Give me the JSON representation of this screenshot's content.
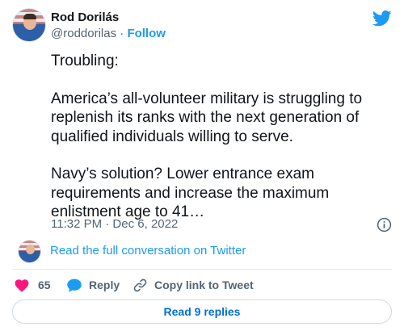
{
  "author": {
    "display_name": "Rod Dorilás",
    "handle": "@roddorilas",
    "separator": "·",
    "follow_label": "Follow"
  },
  "tweet": {
    "paragraphs": [
      "Troubling:",
      "America’s all-volunteer military is struggling to replenish its ranks with the next generation of qualified individuals willing to serve.",
      "Navy’s solution? Lower entrance exam requirements and increase the maximum enlistment age to 41…"
    ],
    "timestamp": "11:32 PM · Dec 6, 2022"
  },
  "conversation": {
    "link_label": "Read the full conversation on Twitter"
  },
  "actions": {
    "like_count": "65",
    "reply_label": "Reply",
    "copy_label": "Copy link to Tweet"
  },
  "footer": {
    "read_replies_label": "Read 9 replies"
  },
  "icons": {
    "brand": "twitter-bird-icon",
    "info": "info-icon",
    "like": "heart-icon",
    "reply": "speech-bubble-icon",
    "copy": "link-icon"
  },
  "colors": {
    "brand_blue": "#1d9bf0",
    "like_pink": "#f91880",
    "reply_blue": "#1d9bf0",
    "text_primary": "#0f1419",
    "text_secondary": "#536471",
    "replies_text": "#006fd6",
    "border": "#cfd9de"
  }
}
